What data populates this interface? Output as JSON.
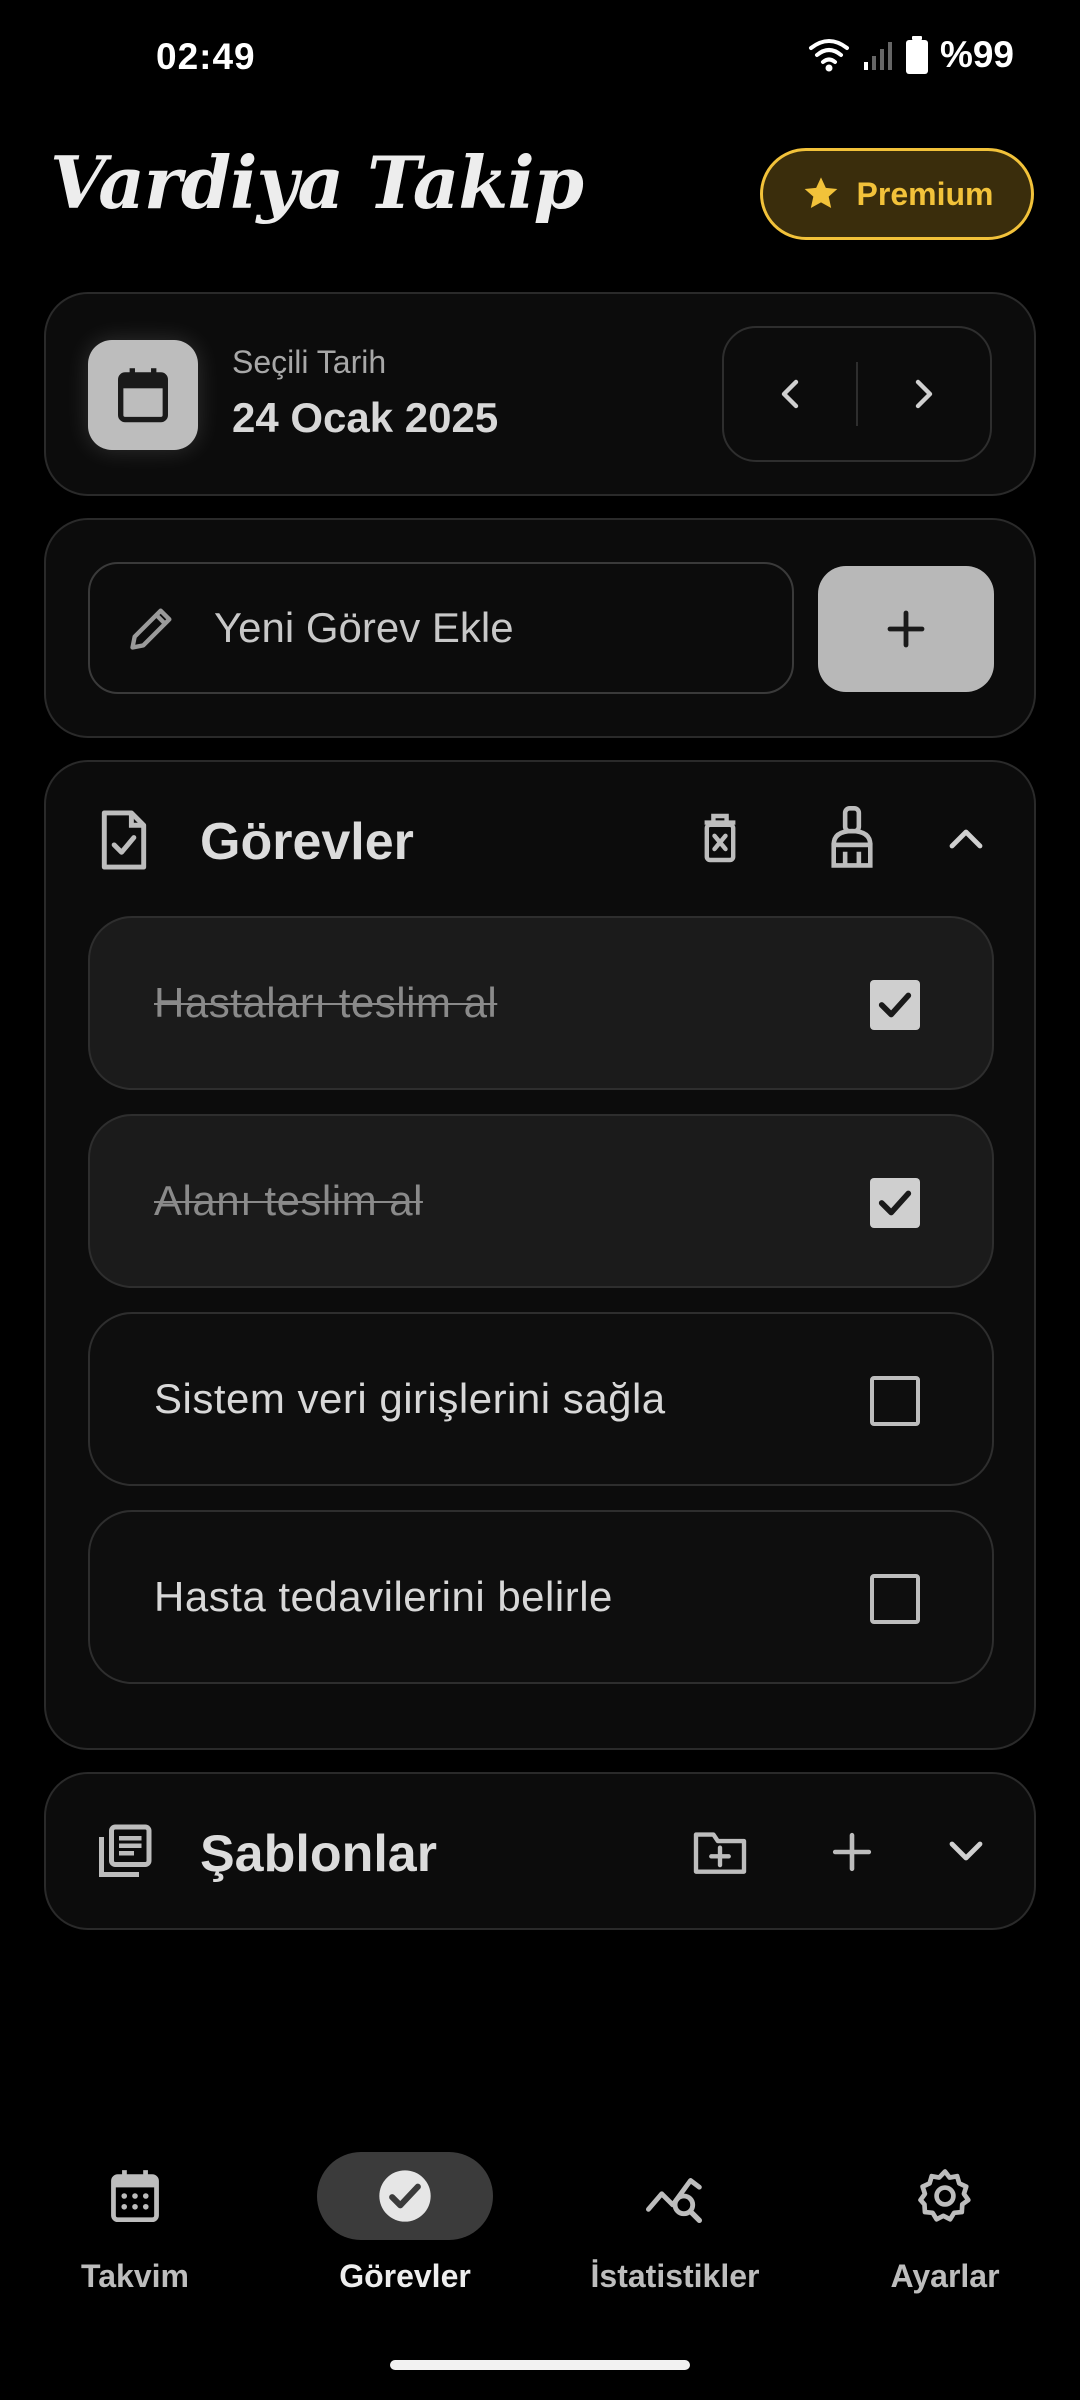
{
  "status_bar": {
    "time": "02:49",
    "battery": "%99"
  },
  "header": {
    "title": "Vardiya Takip",
    "premium_label": "Premium"
  },
  "date_card": {
    "label": "Seçili Tarih",
    "date": "24 Ocak 2025"
  },
  "add_task": {
    "placeholder": "Yeni Görev Ekle"
  },
  "tasks": {
    "title": "Görevler",
    "items": [
      {
        "text": "Hastaları teslim al",
        "done": true
      },
      {
        "text": "Alanı teslim al",
        "done": true
      },
      {
        "text": "Sistem veri girişlerini sağla",
        "done": false
      },
      {
        "text": "Hasta tedavilerini belirle",
        "done": false
      }
    ]
  },
  "templates": {
    "title": "Şablonlar"
  },
  "bottom_nav": {
    "items": [
      {
        "label": "Takvim",
        "icon": "calendar-icon"
      },
      {
        "label": "Görevler",
        "icon": "check-circle-icon",
        "active": true
      },
      {
        "label": "İstatistikler",
        "icon": "stats-icon"
      },
      {
        "label": "Ayarlar",
        "icon": "gear-icon"
      }
    ]
  },
  "colors": {
    "accent_premium": "#f2c23a",
    "background": "#000000",
    "card": "#0c0c0c"
  }
}
